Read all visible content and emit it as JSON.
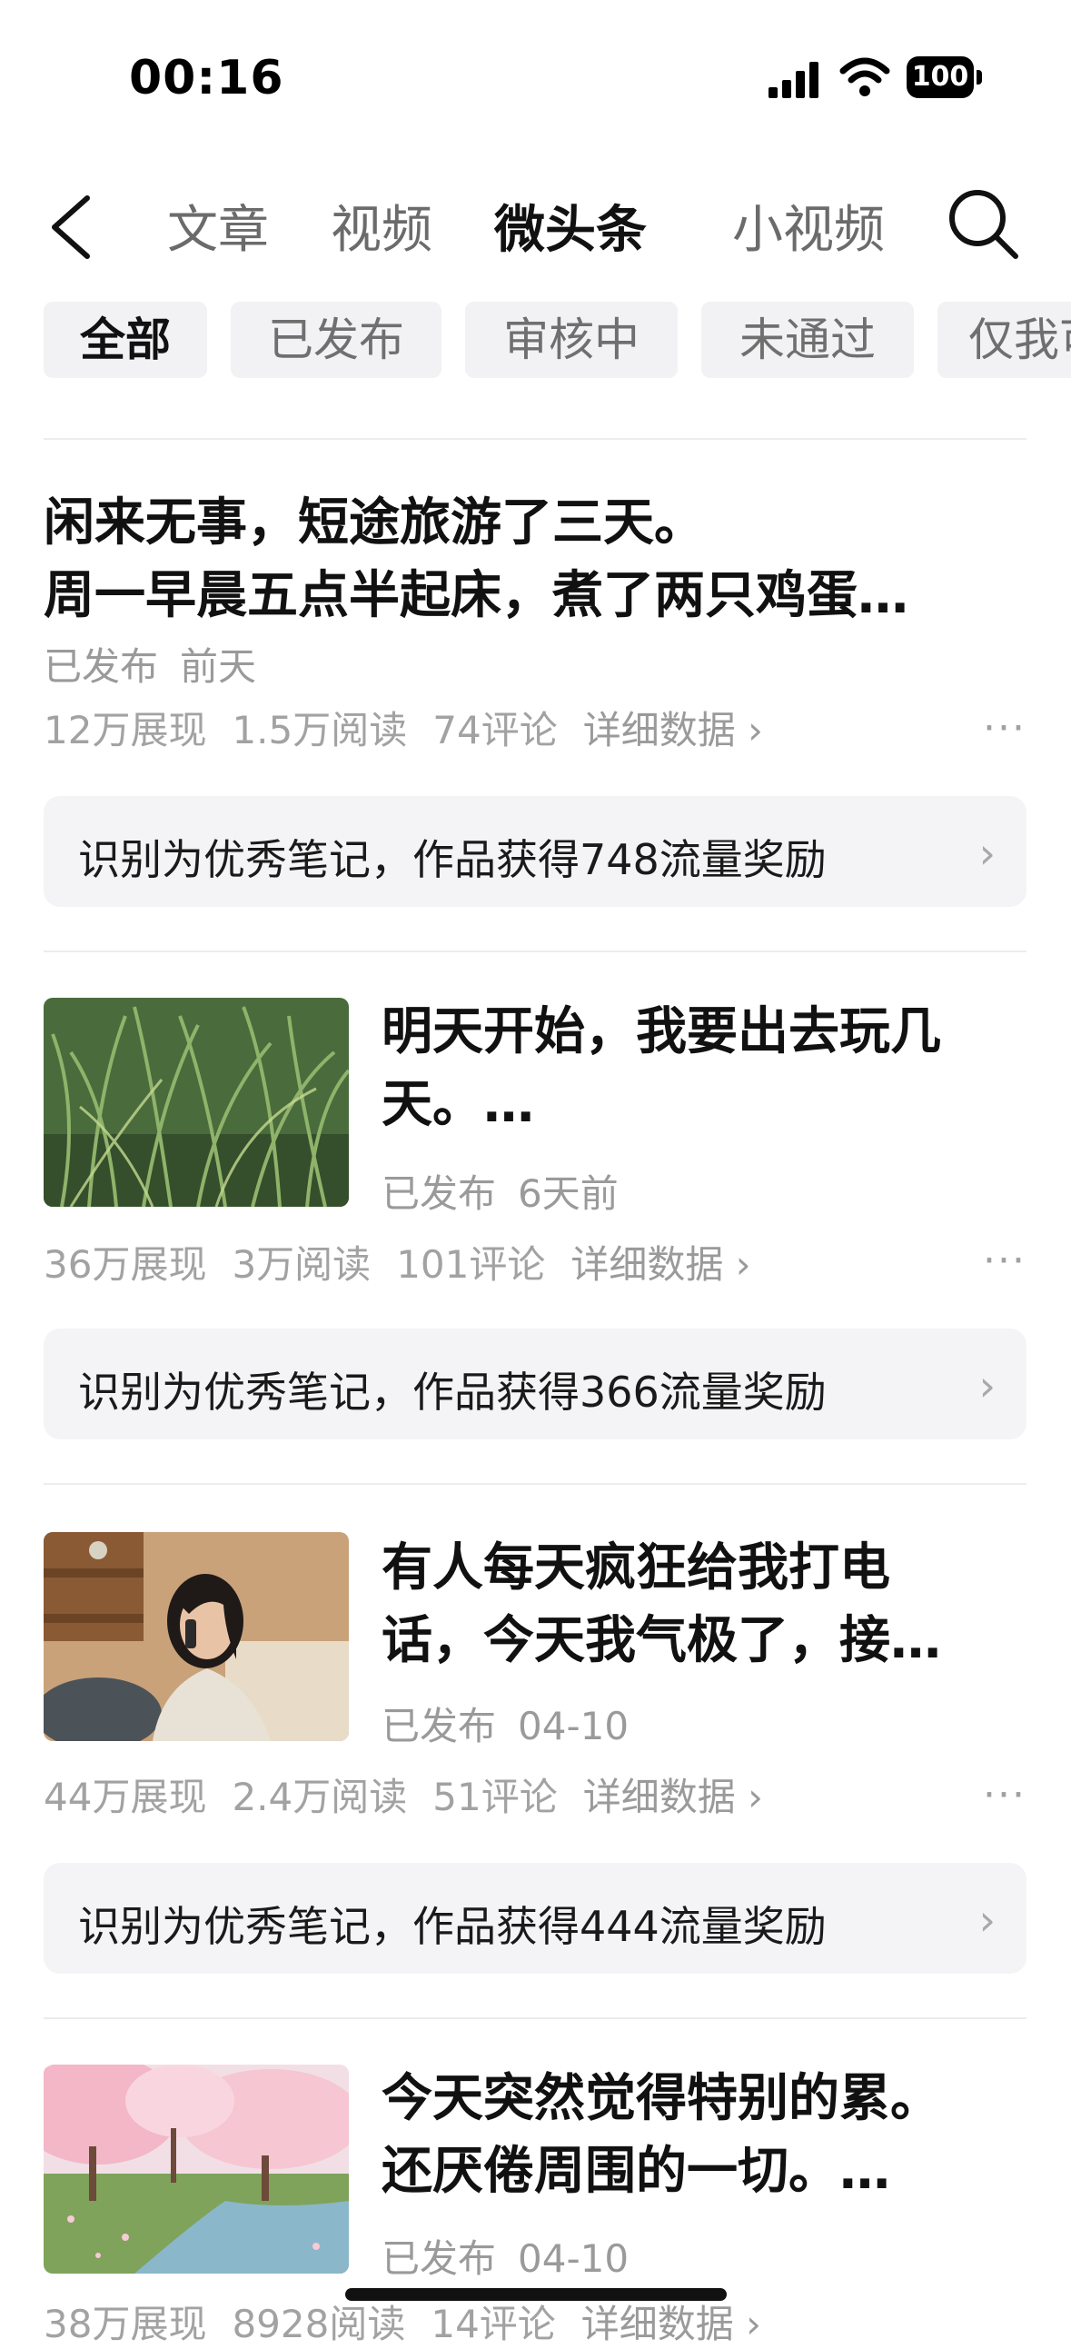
{
  "status_bar": {
    "time": "00:16",
    "battery": "100"
  },
  "nav": {
    "tabs": [
      "文章",
      "视频",
      "微头条",
      "小视频"
    ],
    "active_tab": "微头条"
  },
  "filters": [
    "全部",
    "已发布",
    "审核中",
    "未通过",
    "仅我可见"
  ],
  "posts": [
    {
      "title": "闲来无事，短途旅游了三天。\n周一早晨五点半起床，煮了两只鸡蛋…",
      "status": "已发布",
      "time": "前天",
      "impressions": "12万展现",
      "reads": "1.5万阅读",
      "comments": "74评论",
      "detail": "详细数据",
      "reward": "识别为优秀笔记，作品获得748流量奖励"
    },
    {
      "title": "明天开始，我要出去玩几\n天。…",
      "status": "已发布",
      "time": "6天前",
      "impressions": "36万展现",
      "reads": "3万阅读",
      "comments": "101评论",
      "detail": "详细数据",
      "reward": "识别为优秀笔记，作品获得366流量奖励"
    },
    {
      "title": "有人每天疯狂给我打电\n话，今天我气极了，接…",
      "status": "已发布",
      "time": "04-10",
      "impressions": "44万展现",
      "reads": "2.4万阅读",
      "comments": "51评论",
      "detail": "详细数据",
      "reward": "识别为优秀笔记，作品获得444流量奖励"
    },
    {
      "title": "今天突然觉得特别的累。\n还厌倦周围的一切。…",
      "status": "已发布",
      "time": "04-10",
      "impressions": "38万展现",
      "reads": "8928阅读",
      "comments": "14评论",
      "detail": "详细数据"
    }
  ],
  "icons": {
    "back": "chevron-left-icon",
    "search": "search-icon",
    "more": "more-dots-icon",
    "reward_arrow": "chevron-right-icon"
  }
}
